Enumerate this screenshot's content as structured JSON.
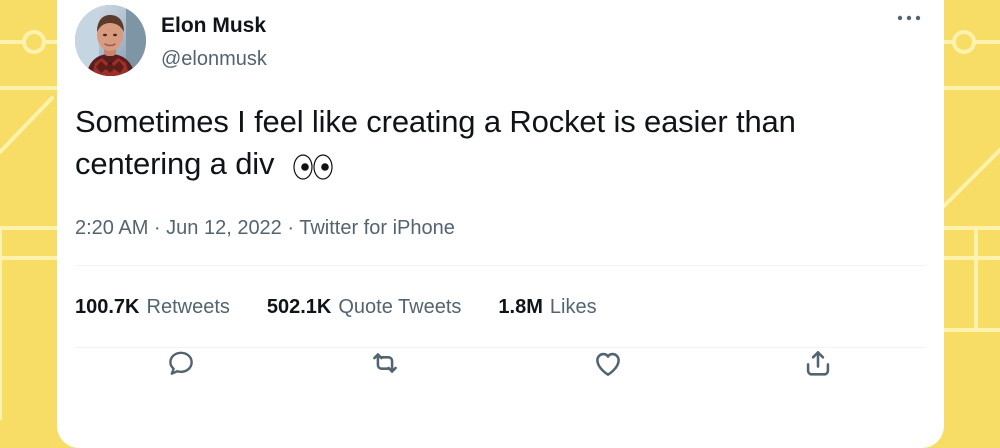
{
  "theme": {
    "background": "#f7dc66",
    "background_line": "#fff2ad",
    "card": "#ffffff",
    "text_primary": "#0f1419",
    "text_secondary": "#536471",
    "divider": "#eff3f4"
  },
  "author": {
    "name": "Elon Musk",
    "handle": "@elonmusk",
    "avatar_icon": "profile-photo"
  },
  "tweet": {
    "text": "Sometimes I feel like creating a Rocket is easier than centering a div",
    "emoji": "👀",
    "emoji_icon": "eyes-emoji"
  },
  "meta": {
    "text": "2:20 AM · Jun 12, 2022 · Twitter for iPhone"
  },
  "stats": [
    {
      "value": "100.7K",
      "label": "Retweets"
    },
    {
      "value": "502.1K",
      "label": "Quote Tweets"
    },
    {
      "value": "1.8M",
      "label": "Likes"
    }
  ],
  "actions": [
    {
      "icon": "reply-icon"
    },
    {
      "icon": "retweet-icon"
    },
    {
      "icon": "like-icon"
    },
    {
      "icon": "share-icon"
    }
  ],
  "more_icon": "more-icon"
}
